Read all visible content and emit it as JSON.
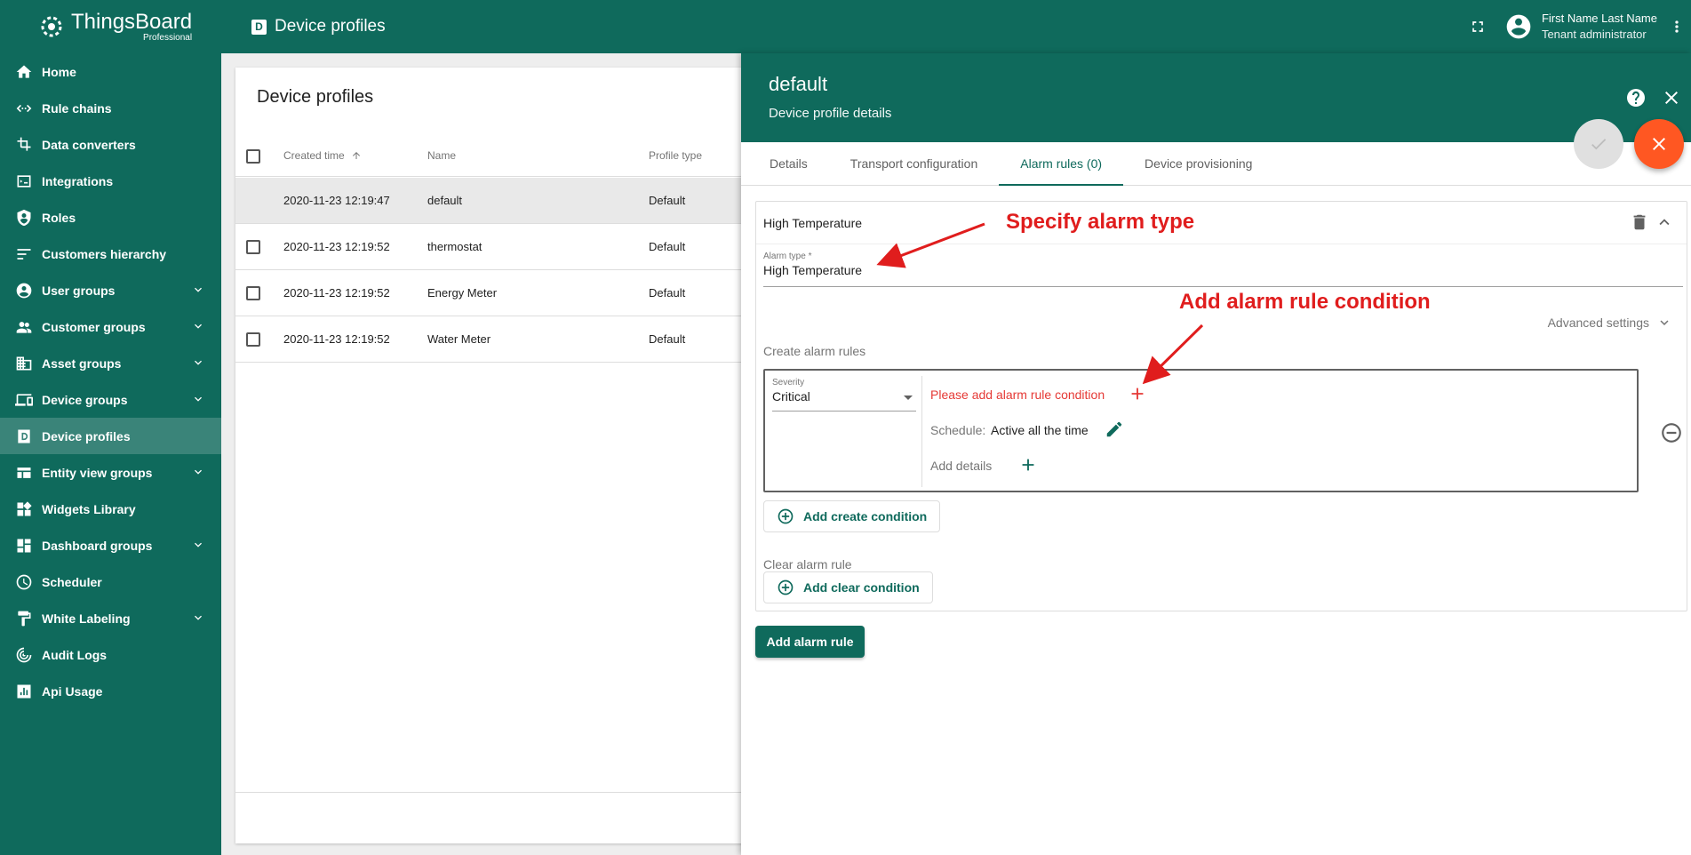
{
  "app": {
    "logo_title": "ThingsBoard",
    "logo_sub": "Professional"
  },
  "sidebar": {
    "items": [
      {
        "label": "Home",
        "icon": "home-icon"
      },
      {
        "label": "Rule chains",
        "icon": "rule-chains-icon"
      },
      {
        "label": "Data converters",
        "icon": "data-converters-icon"
      },
      {
        "label": "Integrations",
        "icon": "integrations-icon"
      },
      {
        "label": "Roles",
        "icon": "roles-icon"
      },
      {
        "label": "Customers hierarchy",
        "icon": "hierarchy-icon"
      },
      {
        "label": "User groups",
        "icon": "user-groups-icon"
      },
      {
        "label": "Customer groups",
        "icon": "customer-groups-icon"
      },
      {
        "label": "Asset groups",
        "icon": "asset-groups-icon"
      },
      {
        "label": "Device groups",
        "icon": "device-groups-icon"
      },
      {
        "label": "Device profiles",
        "icon": "device-profiles-icon"
      },
      {
        "label": "Entity view groups",
        "icon": "entity-view-groups-icon"
      },
      {
        "label": "Widgets Library",
        "icon": "widgets-icon"
      },
      {
        "label": "Dashboard groups",
        "icon": "dashboard-groups-icon"
      },
      {
        "label": "Scheduler",
        "icon": "scheduler-icon"
      },
      {
        "label": "White Labeling",
        "icon": "white-labeling-icon"
      },
      {
        "label": "Audit Logs",
        "icon": "audit-logs-icon"
      },
      {
        "label": "Api Usage",
        "icon": "api-usage-icon"
      }
    ]
  },
  "topbar": {
    "page_icon_letter": "D",
    "title": "Device profiles",
    "user_name": "First Name Last Name",
    "user_role": "Tenant administrator"
  },
  "list": {
    "title": "Device profiles",
    "columns": [
      "Created time",
      "Name",
      "Profile type"
    ],
    "rows": [
      {
        "created": "2020-11-23 12:19:47",
        "name": "default",
        "type": "Default"
      },
      {
        "created": "2020-11-23 12:19:52",
        "name": "thermostat",
        "type": "Default"
      },
      {
        "created": "2020-11-23 12:19:52",
        "name": "Energy Meter",
        "type": "Default"
      },
      {
        "created": "2020-11-23 12:19:52",
        "name": "Water Meter",
        "type": "Default"
      }
    ]
  },
  "details": {
    "title": "default",
    "subtitle": "Device profile details",
    "tabs": [
      "Details",
      "Transport configuration",
      "Alarm rules (0)",
      "Device provisioning"
    ],
    "alarm": {
      "name": "High Temperature",
      "type_label": "Alarm type *",
      "type_value": "High Temperature",
      "advanced_settings": "Advanced settings",
      "create_label": "Create alarm rules",
      "severity_label": "Severity",
      "severity_value": "Critical",
      "condition_prompt": "Please add alarm rule condition",
      "schedule_label": "Schedule:",
      "schedule_value": "Active all the time",
      "add_details": "Add details",
      "add_create_condition": "Add create condition",
      "clear_label": "Clear alarm rule",
      "add_clear_condition": "Add clear condition"
    },
    "add_alarm_rule": "Add alarm rule"
  },
  "annotations": {
    "a1": "Specify alarm type",
    "a2": "Add alarm rule condition"
  },
  "colors": {
    "primary": "#0f6a5c",
    "accent": "#ff5722",
    "annotation": "#e01d1d"
  }
}
